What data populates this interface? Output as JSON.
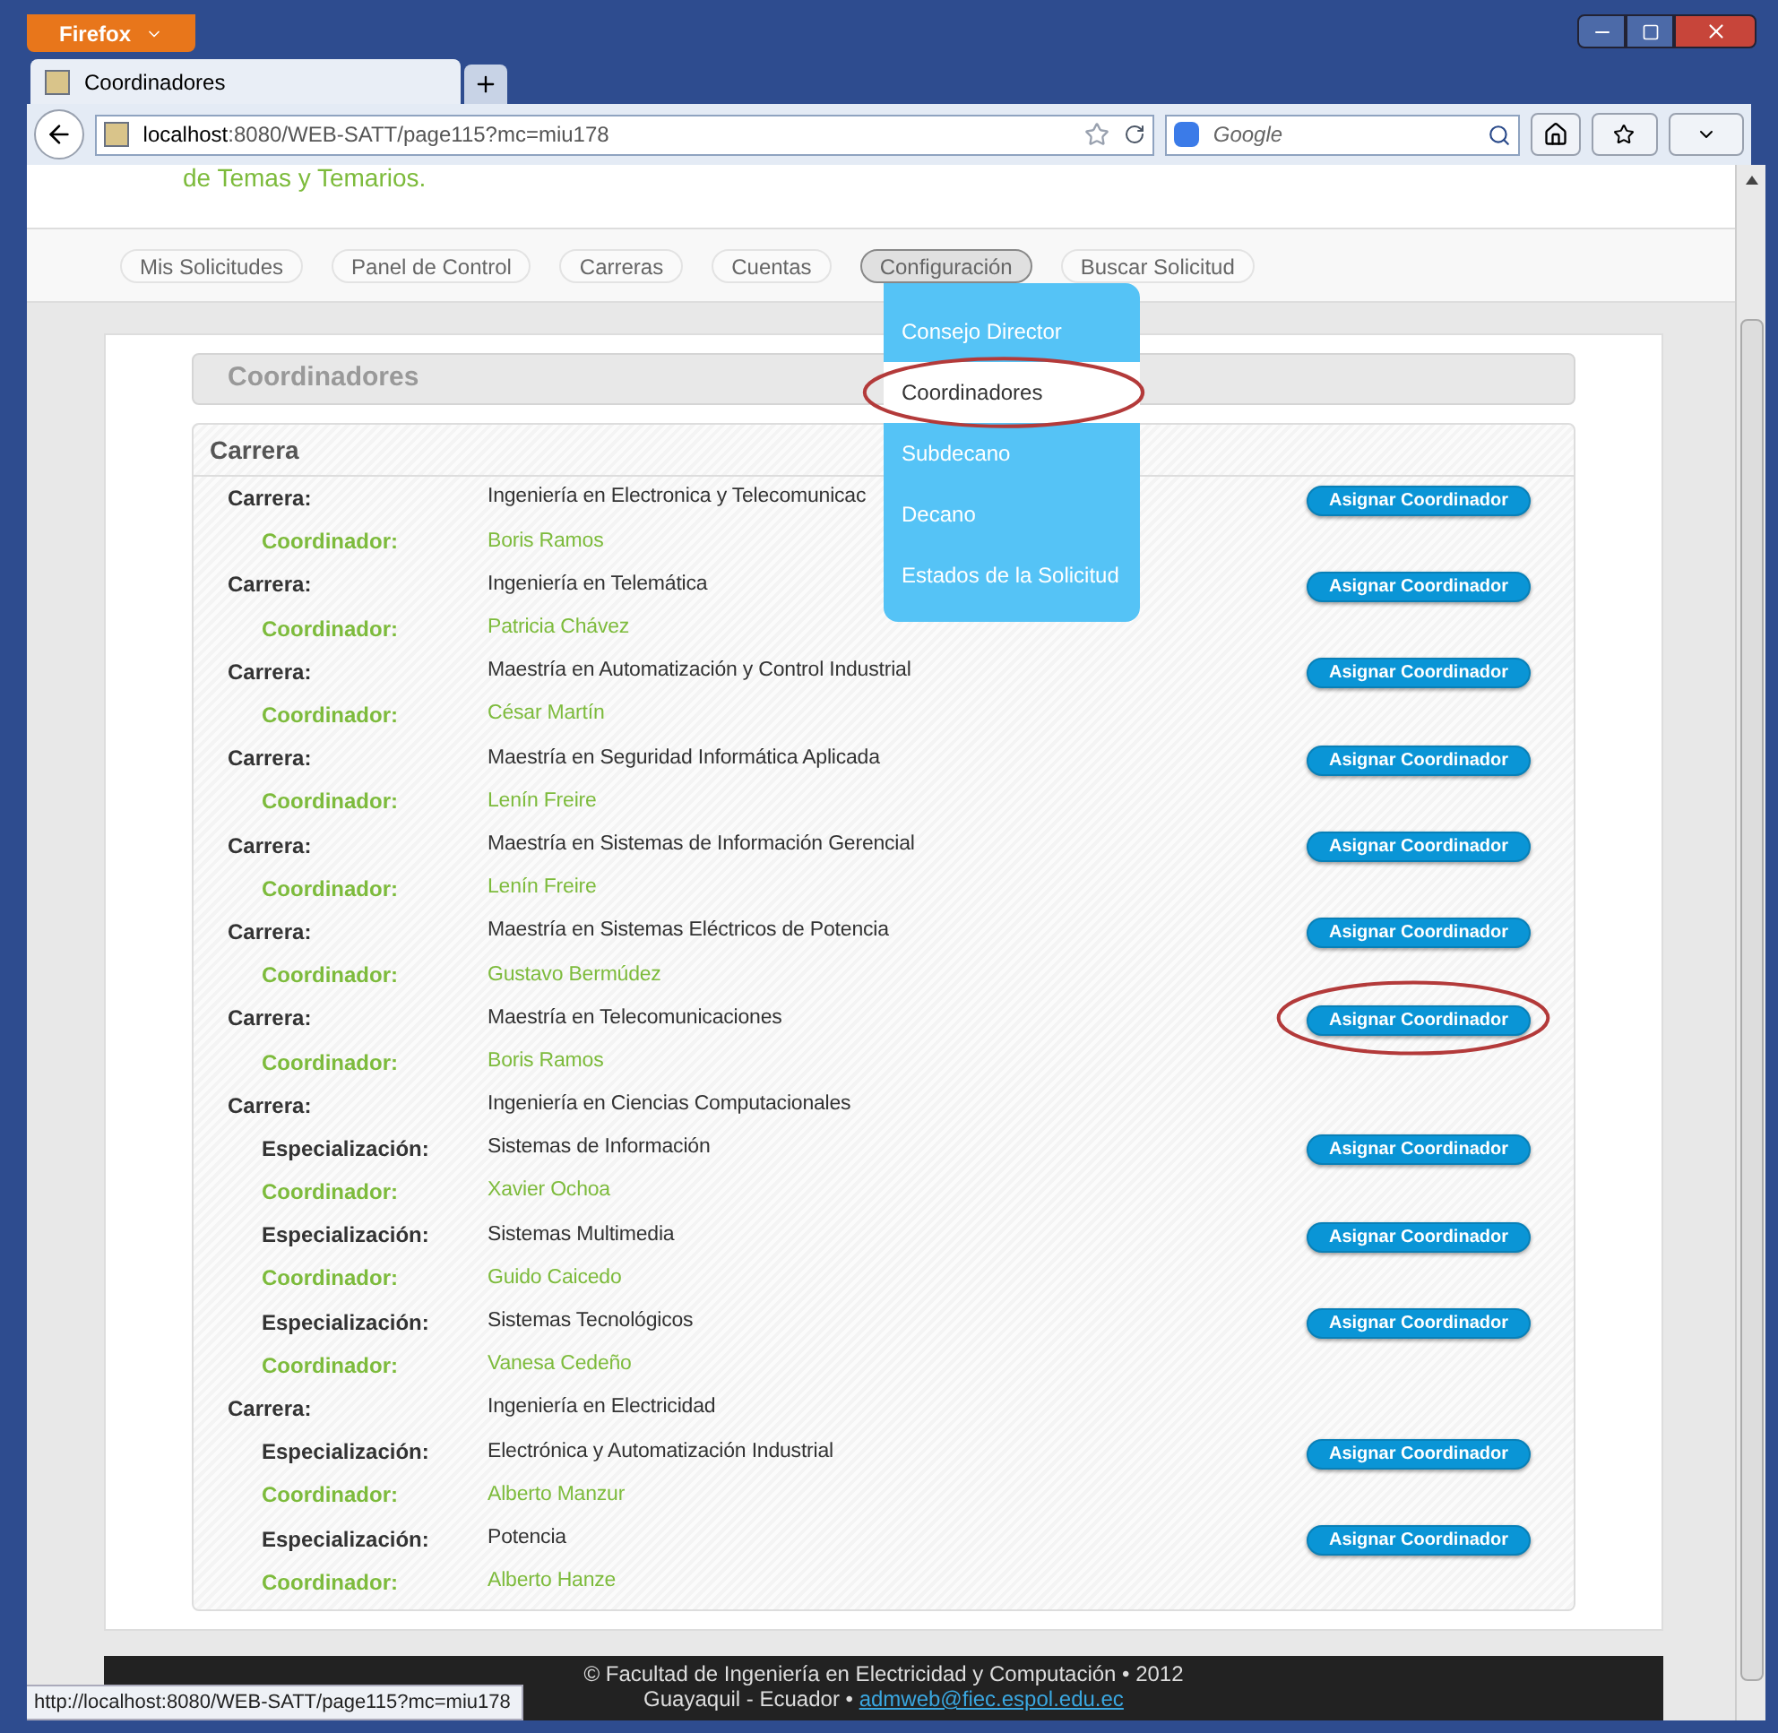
{
  "browser": {
    "menu_button": "Firefox",
    "tabs": [
      {
        "title": "Coordinadores",
        "selected": true
      }
    ],
    "address": {
      "host": "localhost",
      "rest": ":8080/WEB-SATT/page115?mc=miu178"
    },
    "search": {
      "placeholder": "Google"
    }
  },
  "header_text": "de Temas y Temarios.",
  "nav": [
    {
      "label": "Mis Solicitudes",
      "selected": false
    },
    {
      "label": "Panel de Control",
      "selected": false
    },
    {
      "label": "Carreras",
      "selected": false
    },
    {
      "label": "Cuentas",
      "selected": false
    },
    {
      "label": "Configuración",
      "selected": true
    },
    {
      "label": "Buscar Solicitud",
      "selected": false
    }
  ],
  "dropdown": [
    {
      "label": "Consejo Director",
      "selected": false,
      "circled": false
    },
    {
      "label": "Coordinadores",
      "selected": true,
      "circled": true
    },
    {
      "label": "Subdecano",
      "selected": false,
      "circled": false
    },
    {
      "label": "Decano",
      "selected": false,
      "circled": false
    },
    {
      "label": "Estados de la Solicitud",
      "selected": false,
      "circled": false
    }
  ],
  "page_title": "Coordinadores",
  "panel_title": "Carrera",
  "rows": [
    {
      "kind": "carrera",
      "label": "Carrera:",
      "value": "Ingeniería en Electronica y Telecomunicac",
      "button": "Asignar Coordinador",
      "circled": false
    },
    {
      "kind": "coordinador",
      "label": "Coordinador:",
      "value": "Boris Ramos"
    },
    {
      "kind": "carrera",
      "label": "Carrera:",
      "value": "Ingeniería en Telemática",
      "button": "Asignar Coordinador",
      "circled": false
    },
    {
      "kind": "coordinador",
      "label": "Coordinador:",
      "value": "Patricia Chávez"
    },
    {
      "kind": "carrera",
      "label": "Carrera:",
      "value": "Maestría en Automatización y Control Industrial",
      "button": "Asignar Coordinador",
      "circled": false
    },
    {
      "kind": "coordinador",
      "label": "Coordinador:",
      "value": "César Martín"
    },
    {
      "kind": "carrera",
      "label": "Carrera:",
      "value": "Maestría en Seguridad Informática Aplicada",
      "button": "Asignar Coordinador",
      "circled": false
    },
    {
      "kind": "coordinador",
      "label": "Coordinador:",
      "value": "Lenín Freire"
    },
    {
      "kind": "carrera",
      "label": "Carrera:",
      "value": "Maestría en Sistemas de Información Gerencial",
      "button": "Asignar Coordinador",
      "circled": false
    },
    {
      "kind": "coordinador",
      "label": "Coordinador:",
      "value": "Lenín Freire"
    },
    {
      "kind": "carrera",
      "label": "Carrera:",
      "value": "Maestría en Sistemas Eléctricos de Potencia",
      "button": "Asignar Coordinador",
      "circled": false
    },
    {
      "kind": "coordinador",
      "label": "Coordinador:",
      "value": "Gustavo Bermúdez"
    },
    {
      "kind": "carrera",
      "label": "Carrera:",
      "value": "Maestría en Telecomunicaciones",
      "button": "Asignar Coordinador",
      "circled": true
    },
    {
      "kind": "coordinador",
      "label": "Coordinador:",
      "value": "Boris Ramos"
    },
    {
      "kind": "carrera",
      "label": "Carrera:",
      "value": "Ingeniería en Ciencias Computacionales"
    },
    {
      "kind": "especializacion",
      "label": "Especialización:",
      "value": "Sistemas de Información",
      "button": "Asignar Coordinador",
      "circled": false
    },
    {
      "kind": "coordinador",
      "label": "Coordinador:",
      "value": "Xavier Ochoa"
    },
    {
      "kind": "especializacion",
      "label": "Especialización:",
      "value": "Sistemas Multimedia",
      "button": "Asignar Coordinador",
      "circled": false
    },
    {
      "kind": "coordinador",
      "label": "Coordinador:",
      "value": "Guido Caicedo"
    },
    {
      "kind": "especializacion",
      "label": "Especialización:",
      "value": "Sistemas Tecnológicos",
      "button": "Asignar Coordinador",
      "circled": false
    },
    {
      "kind": "coordinador",
      "label": "Coordinador:",
      "value": "Vanesa Cedeño"
    },
    {
      "kind": "carrera",
      "label": "Carrera:",
      "value": "Ingeniería en Electricidad"
    },
    {
      "kind": "especializacion",
      "label": "Especialización:",
      "value": "Electrónica y Automatización Industrial",
      "button": "Asignar Coordinador",
      "circled": false
    },
    {
      "kind": "coordinador",
      "label": "Coordinador:",
      "value": "Alberto Manzur"
    },
    {
      "kind": "especializacion",
      "label": "Especialización:",
      "value": "Potencia",
      "button": "Asignar Coordinador",
      "circled": false
    },
    {
      "kind": "coordinador",
      "label": "Coordinador:",
      "value": "Alberto Hanze"
    }
  ],
  "footer": {
    "line1": "© Facultad de Ingeniería en Electricidad y Computación • 2012",
    "line2": "Guayaquil - Ecuador •",
    "email": "admweb@fiec.espol.edu.ec"
  },
  "status_url": "http://localhost:8080/WEB-SATT/page115?mc=miu178"
}
